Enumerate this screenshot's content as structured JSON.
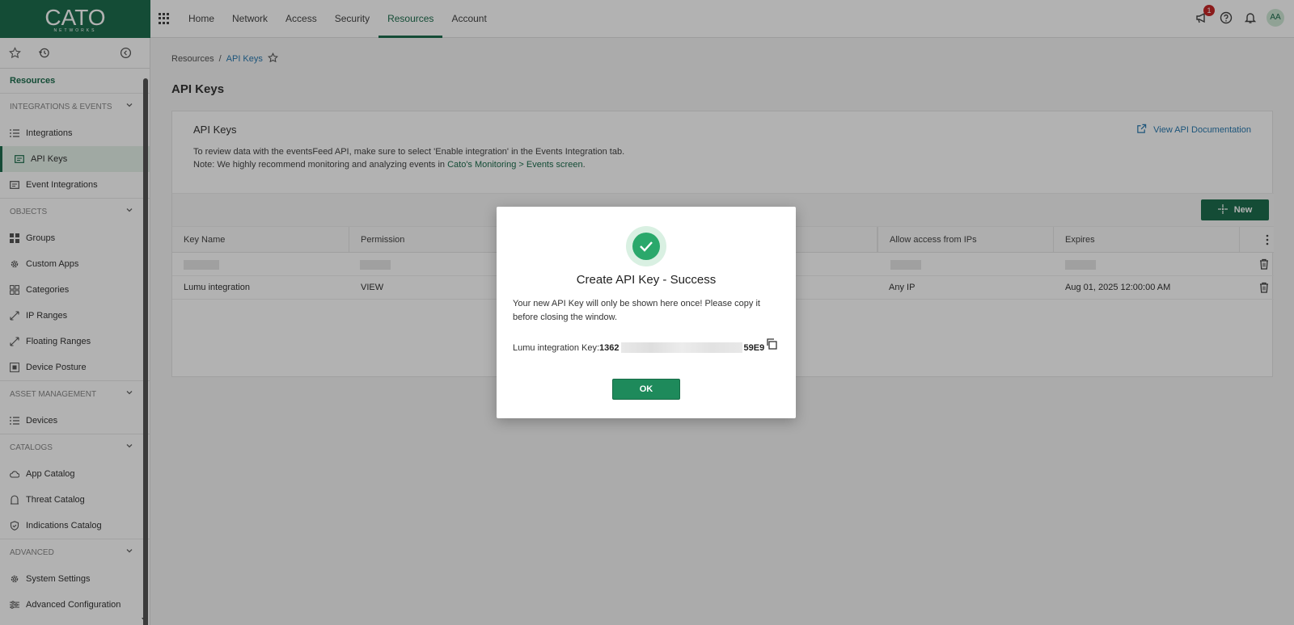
{
  "brand": {
    "name": "CATO",
    "sub": "NETWORKS"
  },
  "nav": {
    "items": [
      {
        "label": "Home"
      },
      {
        "label": "Network"
      },
      {
        "label": "Access"
      },
      {
        "label": "Security"
      },
      {
        "label": "Resources"
      },
      {
        "label": "Account"
      }
    ],
    "active": "Resources"
  },
  "topbar": {
    "notification_count": "1",
    "avatar_initials": "AA"
  },
  "sidebar": {
    "title": "Resources",
    "sections": [
      {
        "label": "INTEGRATIONS & EVENTS",
        "items": [
          {
            "label": "Integrations",
            "icon": "list-icon"
          },
          {
            "label": "API Keys",
            "icon": "key-card-icon",
            "active": true
          },
          {
            "label": "Event Integrations",
            "icon": "card-icon"
          }
        ]
      },
      {
        "label": "OBJECTS",
        "items": [
          {
            "label": "Groups",
            "icon": "grid-icon"
          },
          {
            "label": "Custom Apps",
            "icon": "gear-icon"
          },
          {
            "label": "Categories",
            "icon": "categories-icon"
          },
          {
            "label": "IP Ranges",
            "icon": "range-icon"
          },
          {
            "label": "Floating Ranges",
            "icon": "range-icon"
          },
          {
            "label": "Device Posture",
            "icon": "posture-icon"
          }
        ]
      },
      {
        "label": "ASSET MANAGEMENT",
        "items": [
          {
            "label": "Devices",
            "icon": "list-icon"
          }
        ]
      },
      {
        "label": "CATALOGS",
        "items": [
          {
            "label": "App Catalog",
            "icon": "cloud-icon"
          },
          {
            "label": "Threat Catalog",
            "icon": "threat-icon"
          },
          {
            "label": "Indications Catalog",
            "icon": "shield-icon"
          }
        ]
      },
      {
        "label": "ADVANCED",
        "items": [
          {
            "label": "System Settings",
            "icon": "gear-icon"
          },
          {
            "label": "Advanced Configuration",
            "icon": "sliders-icon"
          }
        ]
      }
    ]
  },
  "breadcrumb": {
    "root": "Resources",
    "sep": "/",
    "current": "API Keys"
  },
  "page": {
    "title": "API Keys"
  },
  "card": {
    "title": "API Keys",
    "doc_link": "View API Documentation",
    "line1": "To review data with the eventsFeed API, make sure to select 'Enable integration' in the Events Integration tab.",
    "line2_prefix": "Note: We highly recommend monitoring and analyzing events in ",
    "line2_link": "Cato's Monitoring > Events screen",
    "line2_suffix": "."
  },
  "toolbar": {
    "new_label": "New"
  },
  "table": {
    "columns": [
      "Key Name",
      "Permission",
      "Allow access from IPs",
      "Expires"
    ],
    "rows": [
      {
        "name": "",
        "permission": "",
        "ips": "",
        "expires": ""
      },
      {
        "name": "Lumu integration",
        "permission": "VIEW",
        "ips": "Any IP",
        "expires": "Aug 01, 2025 12:00:00 AM"
      }
    ]
  },
  "modal": {
    "title": "Create API Key - Success",
    "text": "Your new API Key will only be shown here once! Please copy it before closing the window.",
    "key_label": "Lumu integration Key:",
    "key_prefix": "1362",
    "key_suffix": "59E9",
    "ok_label": "OK"
  },
  "colors": {
    "brand": "#1e6e4e",
    "success": "#2aa86b",
    "link": "#2a7ab0"
  }
}
